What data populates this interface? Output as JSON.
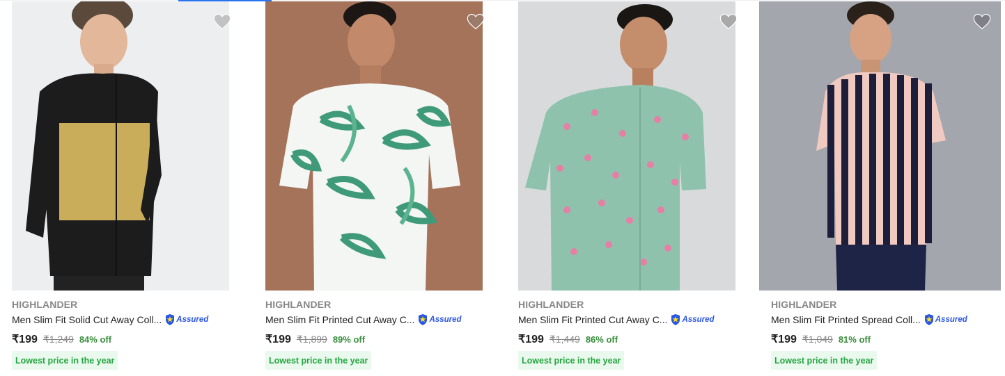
{
  "accent_color": "#2874f0",
  "products": [
    {
      "brand": "HIGHLANDER",
      "title": "Men Slim Fit Solid Cut Away Coll...",
      "assured_label": "Assured",
      "price": "₹199",
      "mrp": "₹1,249",
      "discount": "84% off",
      "tag": "Lowest price in the year",
      "wishlist_icon": "heart-icon"
    },
    {
      "brand": "HIGHLANDER",
      "title": "Men Slim Fit Printed Cut Away C...",
      "assured_label": "Assured",
      "price": "₹199",
      "mrp": "₹1,899",
      "discount": "89% off",
      "tag": "Lowest price in the year",
      "wishlist_icon": "heart-icon"
    },
    {
      "brand": "HIGHLANDER",
      "title": "Men Slim Fit Printed Cut Away C...",
      "assured_label": "Assured",
      "price": "₹199",
      "mrp": "₹1,449",
      "discount": "86% off",
      "tag": "Lowest price in the year",
      "wishlist_icon": "heart-icon"
    },
    {
      "brand": "HIGHLANDER",
      "title": "Men Slim Fit Printed Spread Coll...",
      "assured_label": "Assured",
      "price": "₹199",
      "mrp": "₹1,049",
      "discount": "81% off",
      "tag": "Lowest price in the year",
      "wishlist_icon": "heart-icon"
    }
  ]
}
